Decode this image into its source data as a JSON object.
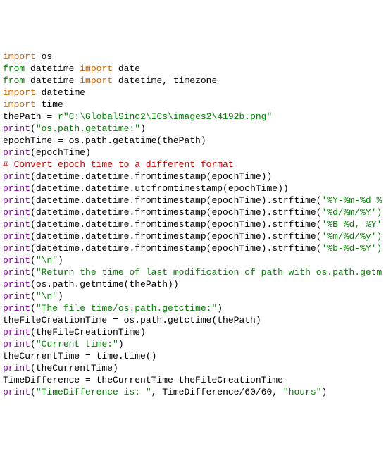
{
  "lines": {
    "l01_import": "import",
    "l01_os": " os",
    "l02_from": "from",
    "l02_mid": " datetime ",
    "l02_import": "import",
    "l02_end": " date",
    "l03_from": "from",
    "l03_mid": " datetime ",
    "l03_import": "import",
    "l03_end": " datetime, timezone",
    "l04_import": "import",
    "l04_end": " datetime",
    "l05_import": "import",
    "l05_end": " time",
    "blank": "",
    "l07_a": "thePath = ",
    "l07_r": "r",
    "l07_str": "\"C:\\GlobalSino2\\ICs\\images2\\4192b.png\"",
    "l09_print": "print",
    "l09_p1": "(",
    "l09_str": "\"os.path.getatime:\"",
    "l09_p2": ")",
    "l10": "epochTime = os.path.getatime(thePath)",
    "l11_print": "print",
    "l11_rest": "(epochTime)",
    "l12_comment": "# Convert epoch time to a different format",
    "l13_print": "print",
    "l13_rest": "(datetime.datetime.fromtimestamp(epochTime))",
    "l14_print": "print",
    "l14_rest": "(datetime.datetime.utcfromtimestamp(epochTime))",
    "l15_print": "print",
    "l15_a": "(datetime.datetime.fromtimestamp(epochTime).strftime(",
    "l15_str": "'%Y-%m-%d %",
    "l16_print": "print",
    "l16_a": "(datetime.datetime.fromtimestamp(epochTime).strftime(",
    "l16_str": "'%d/%m/%Y')",
    "l17_print": "print",
    "l17_a": "(datetime.datetime.fromtimestamp(epochTime).strftime(",
    "l17_str": "'%B %d, %Y'",
    "l18_print": "print",
    "l18_a": "(datetime.datetime.fromtimestamp(epochTime).strftime(",
    "l18_str": "'%m/%d/%y')",
    "l19_print": "print",
    "l19_a": "(datetime.datetime.fromtimestamp(epochTime).strftime(",
    "l19_str": "'%b-%d-%Y')",
    "l21_print": "print",
    "l21_p1": "(",
    "l21_str": "\"\\n\"",
    "l21_p2": ")",
    "l23_print": "print",
    "l23_p1": "(",
    "l23_str": "\"Return the time of last modification of path with os.path.getm",
    "l24_print": "print",
    "l24_rest": "(os.path.getmtime(thePath))",
    "l26_print": "print",
    "l26_p1": "(",
    "l26_str": "\"\\n\"",
    "l26_p2": ")",
    "l28_print": "print",
    "l28_p1": "(",
    "l28_str": "\"The file time/os.path.getctime:\"",
    "l28_p2": ")",
    "l29": "theFileCreationTime = os.path.getctime(thePath)",
    "l30_print": "print",
    "l30_rest": "(theFileCreationTime)",
    "l32_print": "print",
    "l32_p1": "(",
    "l32_str": "\"Current time:\"",
    "l32_p2": ")",
    "l33": "theCurrentTime = time.time()",
    "l34_print": "print",
    "l34_rest": "(theCurrentTime)",
    "l36": "TimeDifference = theCurrentTime-theFileCreationTime",
    "l37_print": "print",
    "l37_p1": "(",
    "l37_str": "\"TimeDifference is: \"",
    "l37_mid": ", TimeDifference/60/60, ",
    "l37_str2": "\"hours\"",
    "l37_p2": ")"
  }
}
